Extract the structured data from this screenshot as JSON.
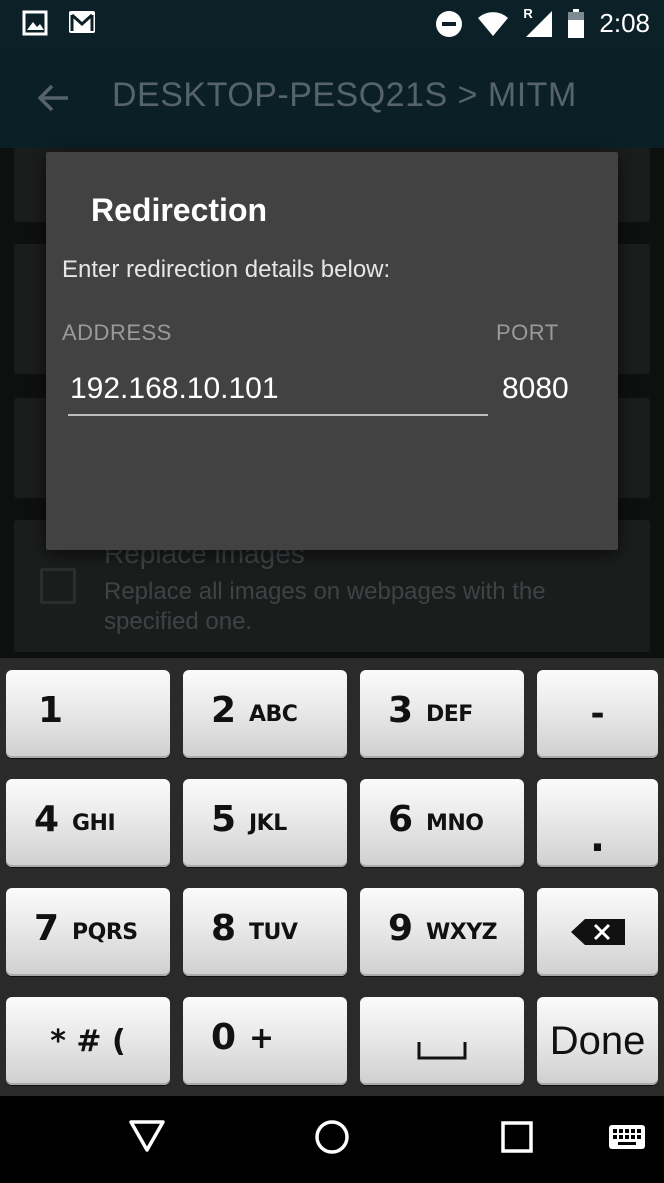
{
  "status_bar": {
    "time": "2:08",
    "network_badge": "R",
    "icons": [
      "image-icon",
      "gmail-icon",
      "do-not-disturb-icon",
      "wifi-icon",
      "signal-icon",
      "battery-icon"
    ]
  },
  "app_bar": {
    "title": "DESKTOP-PESQ21S > MITM"
  },
  "background_list": {
    "replace_images_title": "Replace images",
    "replace_images_desc_line1": "Replace all images on webpages with the",
    "replace_images_desc_line2": "specified one."
  },
  "dialog": {
    "title": "Redirection",
    "message": "Enter redirection details below:",
    "address_label": "ADDRESS",
    "port_label": "PORT",
    "address_value": "192.168.10.101",
    "port_value": "8080"
  },
  "keyboard": {
    "rows": [
      [
        {
          "num": "1",
          "letters": ""
        },
        {
          "num": "2",
          "letters": "ABC"
        },
        {
          "num": "3",
          "letters": "DEF"
        },
        {
          "symbol": "-"
        }
      ],
      [
        {
          "num": "4",
          "letters": "GHI"
        },
        {
          "num": "5",
          "letters": "JKL"
        },
        {
          "num": "6",
          "letters": "MNO"
        },
        {
          "symbol": "."
        }
      ],
      [
        {
          "num": "7",
          "letters": "PQRS"
        },
        {
          "num": "8",
          "letters": "TUV"
        },
        {
          "num": "9",
          "letters": "WXYZ"
        },
        {
          "symbol": "backspace-icon"
        }
      ],
      [
        {
          "symbol": "* # ("
        },
        {
          "num": "0",
          "letters": "+"
        },
        {
          "symbol": "space-icon"
        },
        {
          "symbol": "Done"
        }
      ]
    ]
  },
  "nav_bar": {
    "icons": [
      "back-icon",
      "home-icon",
      "recents-icon",
      "keyboard-icon"
    ]
  }
}
